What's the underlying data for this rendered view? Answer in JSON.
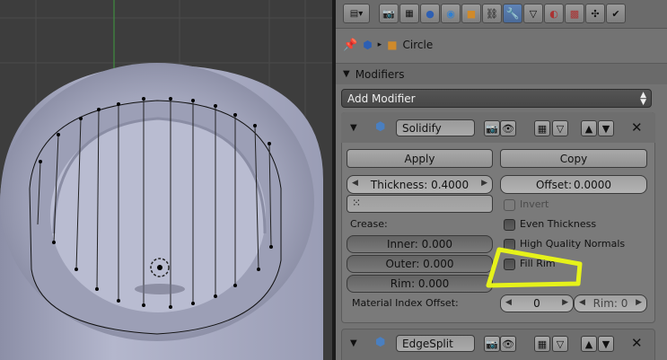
{
  "header": {
    "toolbar_icons": [
      "view-menu-icon",
      "render-icon",
      "render-layers-icon",
      "scene-icon",
      "world-icon",
      "object-icon",
      "constraints-icon",
      "modifiers-icon",
      "data-icon",
      "material-icon",
      "texture-icon",
      "particles-icon",
      "physics-icon"
    ],
    "breadcrumb_object": "Circle"
  },
  "modifiers_panel": {
    "title": "Modifiers",
    "add_modifier_label": "Add Modifier"
  },
  "solidify": {
    "name": "Solidify",
    "apply_label": "Apply",
    "copy_label": "Copy",
    "thickness_label": "Thickness: 0.4000",
    "offset_label": "Offset:",
    "offset_value": "0.0000",
    "invert_label": "Invert",
    "even_thickness_label": "Even Thickness",
    "high_quality_label": "High Quality Normals",
    "crease_label": "Crease:",
    "inner_label": "Inner: 0.000",
    "outer_label": "Outer: 0.000",
    "rim_crease_label": "Rim: 0.000",
    "fill_rim_label": "Fill Rim",
    "material_index_label": "Material Index Offset:",
    "material_offset_value": "0",
    "rim_material_label": "Rim: 0"
  },
  "edgesplit": {
    "name": "EdgeSplit"
  },
  "annotation": {
    "highlight_color": "#e6f21a"
  }
}
